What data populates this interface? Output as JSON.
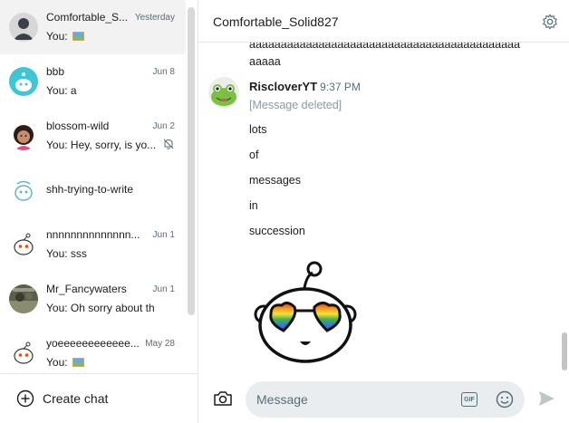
{
  "chats": [
    {
      "name": "Comfortable_S...",
      "date": "Yesterday",
      "preview": "You: ",
      "preview_icon": "image-emoji",
      "avatar": "default-avatar"
    },
    {
      "name": "bbb",
      "date": "Jun 8",
      "preview": "You: a",
      "avatar": "teal-snoo-avatar"
    },
    {
      "name": "blossom-wild",
      "date": "Jun 2",
      "preview": "You: Hey, sorry, is yo...",
      "avatar": "girl-avatar",
      "muted": true
    },
    {
      "name": "shh-trying-to-write",
      "date": "",
      "preview": "",
      "avatar": "snoo-outline-avatar"
    },
    {
      "name": "nnnnnnnnnnnnnn...",
      "date": "Jun 1",
      "preview": "You: sss",
      "avatar": "snoo-avatar"
    },
    {
      "name": "Mr_Fancywaters",
      "date": "Jun 1",
      "preview": "You: Oh sorry about th...",
      "avatar": "photo-avatar"
    },
    {
      "name": "yoeeeeeeeeeeee...",
      "date": "May 28",
      "preview": "You: ",
      "preview_icon": "image-emoji",
      "avatar": "snoo-avatar"
    }
  ],
  "sidebar": {
    "create_chat": "Create chat"
  },
  "header": {
    "title": "Comfortable_Solid827"
  },
  "messages": {
    "continued_line_1": "aaaaaaaaaaaaaaaaaaaaaaaaaaaaaaaaaaaaaaaaaaa",
    "continued_line_2": "aaaaa",
    "author": "RiscloverYT",
    "time": "9:37 PM",
    "deleted": "[Message deleted]",
    "lines": [
      "lots",
      "of",
      "messages",
      "in",
      "succession"
    ]
  },
  "composer": {
    "placeholder": "Message",
    "gif_label": "GIF"
  },
  "colors": {
    "accent": "#1c1c1c",
    "muted_text": "#576f76",
    "deleted_text": "#8a9ba1",
    "input_bg": "#eaedef",
    "active_bg": "#f2f2f2"
  }
}
